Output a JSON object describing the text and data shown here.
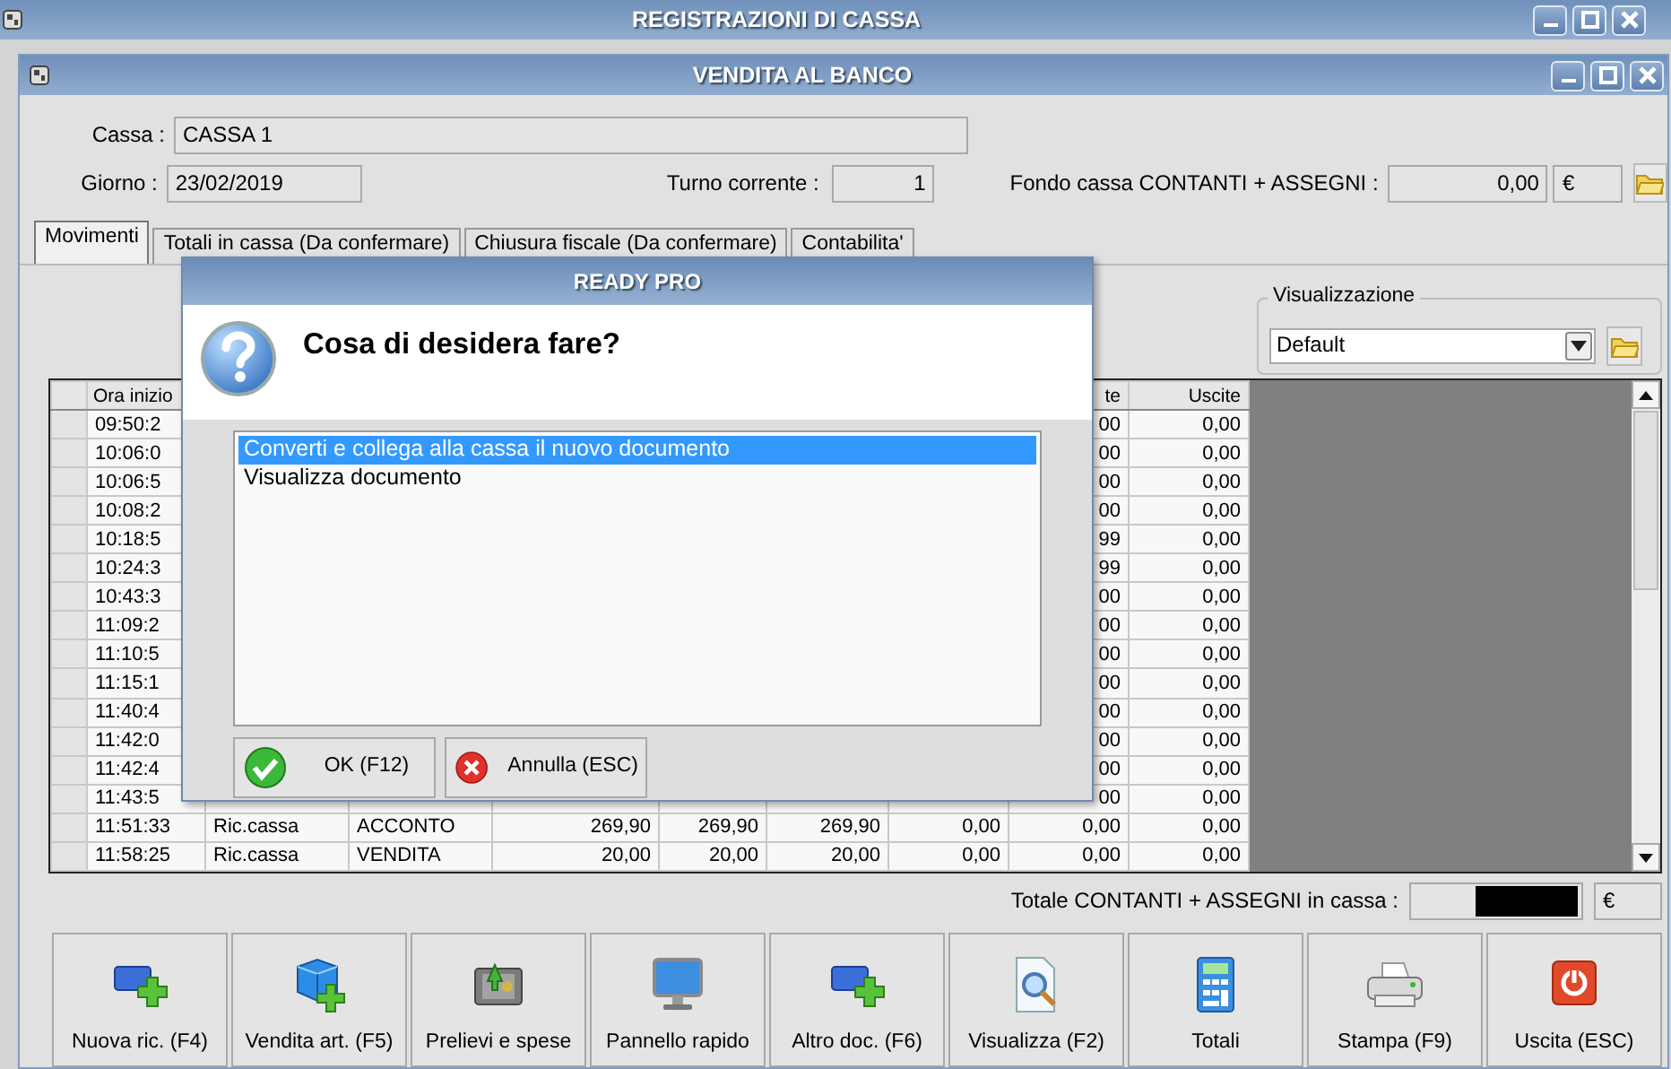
{
  "outer_window": {
    "title": "REGISTRAZIONI DI CASSA"
  },
  "window": {
    "title": "VENDITA AL BANCO"
  },
  "cassa": {
    "label": "Cassa :",
    "value": "CASSA 1"
  },
  "giorno": {
    "label": "Giorno :",
    "value": "23/02/2019"
  },
  "turno": {
    "label": "Turno corrente :",
    "value": "1"
  },
  "fondo": {
    "label": "Fondo cassa CONTANTI + ASSEGNI :",
    "value": "0,00",
    "currency": "€"
  },
  "tabs": [
    {
      "label": "Movimenti",
      "selected": true
    },
    {
      "label": "Totali in cassa (Da confermare)",
      "selected": false
    },
    {
      "label": "Chiusura fiscale (Da confermare)",
      "selected": false
    },
    {
      "label": "Contabilita'",
      "selected": false
    }
  ],
  "view": {
    "label": "Visualizzazione",
    "value": "Default"
  },
  "table": {
    "header": {
      "column_1": "Ora inizio",
      "column_8": "te",
      "column_9": "Uscite"
    },
    "rows": [
      {
        "column_1": "09:50:2",
        "column_8": "00",
        "column_9": "0,00"
      },
      {
        "column_1": "10:06:0",
        "column_8": "00",
        "column_9": "0,00"
      },
      {
        "column_1": "10:06:5",
        "column_8": "00",
        "column_9": "0,00"
      },
      {
        "column_1": "10:08:2",
        "column_8": "00",
        "column_9": "0,00"
      },
      {
        "column_1": "10:18:5",
        "column_8": "99",
        "column_9": "0,00"
      },
      {
        "column_1": "10:24:3",
        "column_8": "99",
        "column_9": "0,00"
      },
      {
        "column_1": "10:43:3",
        "column_8": "00",
        "column_9": "0,00"
      },
      {
        "column_1": "11:09:2",
        "column_8": "00",
        "column_9": "0,00"
      },
      {
        "column_1": "11:10:5",
        "column_8": "00",
        "column_9": "0,00"
      },
      {
        "column_1": "11:15:1",
        "column_8": "00",
        "column_9": "0,00"
      },
      {
        "column_1": "11:40:4",
        "column_8": "00",
        "column_9": "0,00"
      },
      {
        "column_1": "11:42:0",
        "column_8": "00",
        "column_9": "0,00"
      },
      {
        "column_1": "11:42:4",
        "column_8": "00",
        "column_9": "0,00"
      },
      {
        "column_1": "11:43:5",
        "column_8": "00",
        "column_9": "0,00"
      },
      {
        "column_1": "11:51:33",
        "column_2": "Ric.cassa",
        "column_3": "ACCONTO",
        "column_4": "269,90",
        "column_5": "269,90",
        "column_6": "269,90",
        "column_7": "0,00",
        "column_8": "0,00",
        "column_9": "0,00"
      },
      {
        "column_1": "11:58:25",
        "column_2": "Ric.cassa",
        "column_3": "VENDITA",
        "column_4": "20,00",
        "column_5": "20,00",
        "column_6": "20,00",
        "column_7": "0,00",
        "column_8": "0,00",
        "column_9": "0,00"
      }
    ]
  },
  "total": {
    "label": "Totale CONTANTI + ASSEGNI in cassa :",
    "currency": "€"
  },
  "buttons": [
    {
      "label": "Nuova ric. (F4)",
      "kind": "card-plus"
    },
    {
      "label": "Vendita art. (F5)",
      "kind": "cube-plus"
    },
    {
      "label": "Prelievi e spese",
      "kind": "safe"
    },
    {
      "label": "Pannello rapido",
      "kind": "monitor"
    },
    {
      "label": "Altro doc. (F6)",
      "kind": "card-plus"
    },
    {
      "label": "Visualizza (F2)",
      "kind": "doc-search"
    },
    {
      "label": "Totali",
      "kind": "calculator"
    },
    {
      "label": "Stampa (F9)",
      "kind": "printer"
    },
    {
      "label": "Uscita (ESC)",
      "kind": "power"
    }
  ],
  "dialog": {
    "title": "READY PRO",
    "question": "Cosa di desidera fare?",
    "options": [
      {
        "label": "Converti e collega alla cassa il nuovo documento",
        "selected": true
      },
      {
        "label": "Visualizza documento",
        "selected": false
      }
    ],
    "buttons": [
      {
        "label": "OK (F12)",
        "kind": "ok"
      },
      {
        "label": "Annulla (ESC)",
        "kind": "cancel"
      }
    ]
  }
}
